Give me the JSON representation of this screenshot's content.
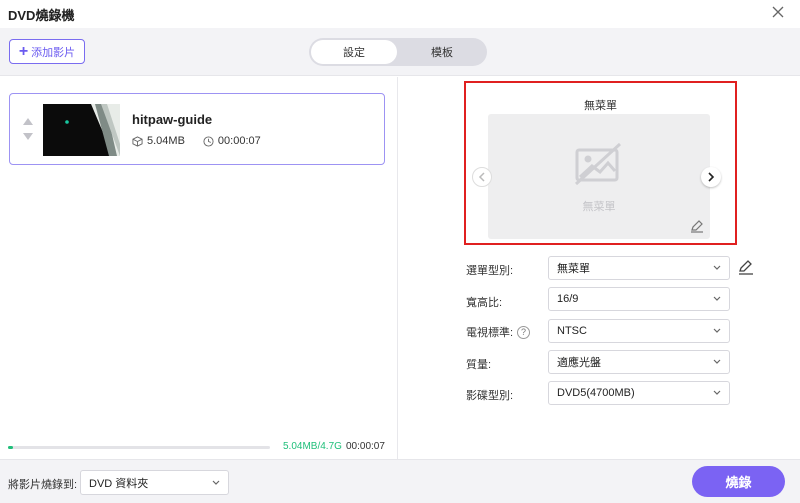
{
  "window": {
    "title": "DVD燒錄機"
  },
  "toolbar": {
    "add_label": "添加影片"
  },
  "tabs": [
    {
      "label": "設定",
      "active": true
    },
    {
      "label": "模板",
      "active": false
    }
  ],
  "video": {
    "name": "hitpaw-guide",
    "size": "5.04MB",
    "duration": "00:00:07"
  },
  "storage": {
    "used_text": "5.04MB/4.7G",
    "total_duration": "00:00:07",
    "progress_fraction": 0.005
  },
  "preview": {
    "title": "無菜單",
    "placeholder_text": "無菜單"
  },
  "settings": {
    "menu_type": {
      "label": "選單型別:",
      "value": "無菜單"
    },
    "aspect_ratio": {
      "label": "寬高比:",
      "value": "16/9"
    },
    "tv_standard": {
      "label": "電視標準:",
      "value": "NTSC",
      "help": "?"
    },
    "quality": {
      "label": "質量:",
      "value": "適應光盤"
    },
    "disc_type": {
      "label": "影碟型別:",
      "value": "DVD5(4700MB)"
    }
  },
  "footer": {
    "burn_to_label": "將影片燒錄到:",
    "burn_to_value": "DVD 資料夾",
    "burn_button": "燒錄"
  },
  "colors": {
    "accent": "#7b63f3",
    "progress": "#1fbf7a",
    "highlight_border": "#e02020"
  }
}
